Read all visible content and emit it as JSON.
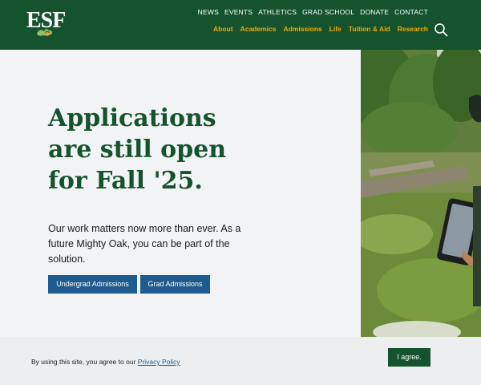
{
  "header": {
    "logo_text": "ESF",
    "utility_nav": [
      "NEWS",
      "EVENTS",
      "ATHLETICS",
      "GRAD SCHOOL",
      "DONATE",
      "CONTACT"
    ],
    "main_nav": [
      "About",
      "Academics",
      "Admissions",
      "Life",
      "Tuition & Aid",
      "Research"
    ],
    "search_icon": "search-icon"
  },
  "hero": {
    "headline": "Applications are still open for Fall '25.",
    "subtext": "Our work matters now more than ever. As a future Mighty Oak, you can be part of the solution.",
    "cta_undergrad": "Undergrad Admissions",
    "cta_grad": "Grad Admissions"
  },
  "cookie": {
    "text": "By using this site, you agree to our",
    "link": "Privacy Policy",
    "agree": "I agree."
  },
  "colors": {
    "brand_green": "#14532d",
    "accent_gold": "#f2a900",
    "button_blue": "#1e5b8e"
  }
}
